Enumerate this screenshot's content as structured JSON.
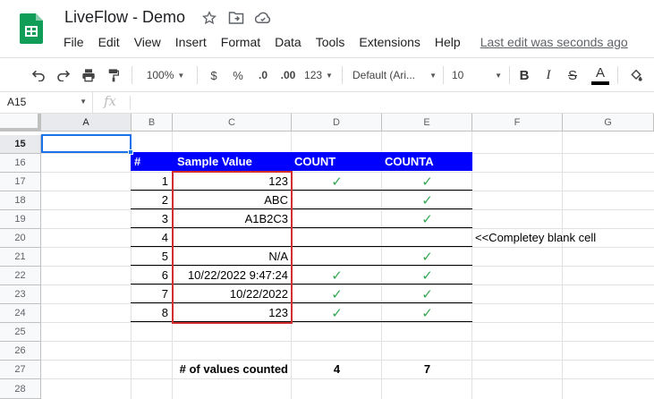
{
  "app": {
    "title": "LiveFlow - Demo",
    "last_edit": "Last edit was seconds ago",
    "accent_color": "#0f9d58"
  },
  "menu": [
    "File",
    "Edit",
    "View",
    "Insert",
    "Format",
    "Data",
    "Tools",
    "Extensions",
    "Help"
  ],
  "toolbar": {
    "zoom": "100%",
    "currency": "$",
    "percent": "%",
    "decrease_decimal": ".0",
    "increase_decimal": ".00",
    "more_formats": "123",
    "font": "Default (Ari...",
    "font_size": "10",
    "bold": "B",
    "italic": "I",
    "strikethrough": "S",
    "text_color": "A"
  },
  "formula_bar": {
    "name_box": "A15",
    "fx": "fx",
    "value": ""
  },
  "columns": [
    "A",
    "B",
    "C",
    "D",
    "E",
    "F",
    "G"
  ],
  "selected_column": "A",
  "rows": [
    "15",
    "16",
    "17",
    "18",
    "19",
    "20",
    "21",
    "22",
    "23",
    "24",
    "25",
    "26",
    "27",
    "28"
  ],
  "selected_row": "15",
  "table": {
    "header": {
      "num": "#",
      "sample": "Sample Value",
      "count": "COUNT",
      "counta": "COUNTA"
    },
    "header_color": "#0000ff",
    "rows": [
      {
        "n": "1",
        "value": "123",
        "count": "✓",
        "counta": "✓"
      },
      {
        "n": "2",
        "value": "ABC",
        "count": "",
        "counta": "✓"
      },
      {
        "n": "3",
        "value": "A1B2C3",
        "count": "",
        "counta": "✓"
      },
      {
        "n": "4",
        "value": "",
        "count": "",
        "counta": ""
      },
      {
        "n": "5",
        "value": "N/A",
        "count": "",
        "counta": "✓"
      },
      {
        "n": "6",
        "value": "10/22/2022 9:47:24",
        "count": "✓",
        "counta": "✓"
      },
      {
        "n": "7",
        "value": "10/22/2022",
        "count": "✓",
        "counta": "✓"
      },
      {
        "n": "8",
        "value": "123",
        "count": "✓",
        "counta": "✓"
      }
    ],
    "note": "<<Completey blank cell",
    "summary_label": "# of values counted",
    "count_total": "4",
    "counta_total": "7"
  }
}
